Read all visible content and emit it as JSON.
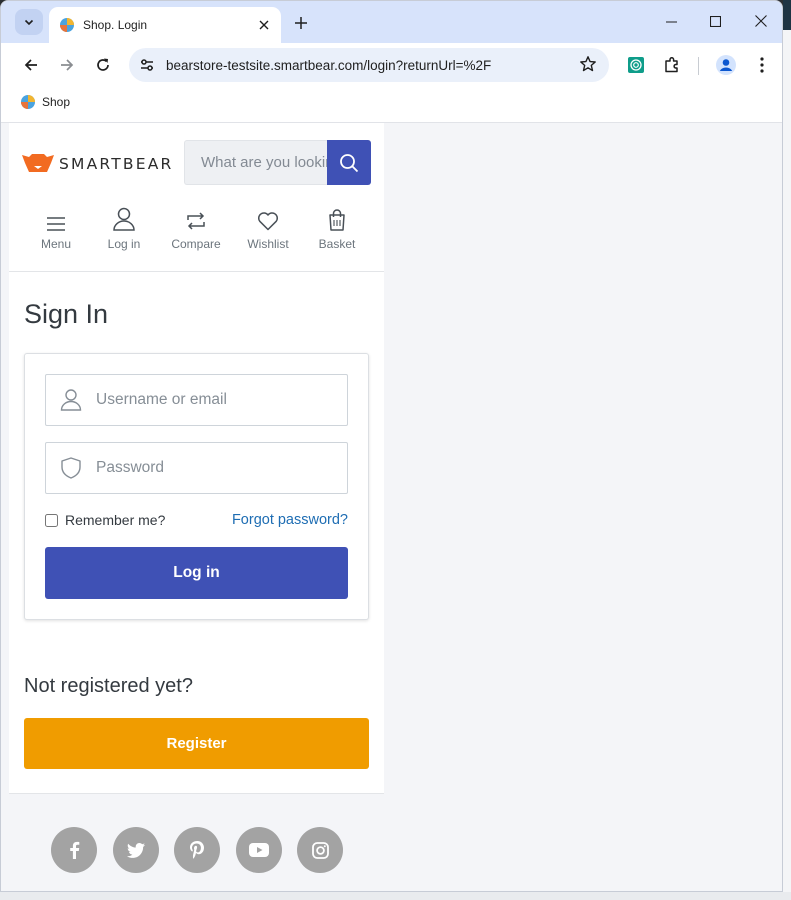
{
  "browser": {
    "tab_title": "Shop. Login",
    "url": "bearstore-testsite.smartbear.com/login?returnUrl=%2F",
    "bookmark_label": "Shop"
  },
  "header": {
    "brand": "SMARTBEAR",
    "search_placeholder": "What are you looking for?",
    "nav": [
      {
        "label": "Menu",
        "icon": "menu-icon"
      },
      {
        "label": "Log in",
        "icon": "user-icon"
      },
      {
        "label": "Compare",
        "icon": "compare-icon"
      },
      {
        "label": "Wishlist",
        "icon": "heart-icon"
      },
      {
        "label": "Basket",
        "icon": "basket-icon"
      }
    ]
  },
  "signin": {
    "heading": "Sign In",
    "username_placeholder": "Username or email",
    "password_placeholder": "Password",
    "remember_label": "Remember me?",
    "forgot_label": "Forgot password?",
    "login_button": "Log in"
  },
  "register": {
    "heading": "Not registered yet?",
    "button": "Register"
  },
  "footer": {
    "social": [
      "facebook-icon",
      "twitter-icon",
      "pinterest-icon",
      "youtube-icon",
      "instagram-icon"
    ]
  },
  "colors": {
    "primary": "#3f51b5",
    "register": "#f09c00",
    "link": "#1e6db3",
    "brand_orange": "#f26b21"
  }
}
